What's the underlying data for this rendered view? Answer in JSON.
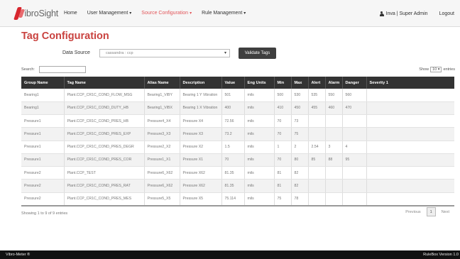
{
  "brand": {
    "name": "VibroSight"
  },
  "nav": {
    "items": [
      {
        "label": "Home",
        "caret": ""
      },
      {
        "label": "User Management",
        "caret": "▾"
      },
      {
        "label": "Source Configuration",
        "caret": "▾"
      },
      {
        "label": "Rule Management",
        "caret": "▾"
      }
    ],
    "active_color": "#e2565a",
    "user": "Inva | Super Admin",
    "logout": "Logout"
  },
  "page": {
    "title": "Tag Configuration",
    "title_color": "#c9423f"
  },
  "datasource": {
    "label": "Data Source",
    "value": "cassandra : ccp",
    "validate_label": "Validate Tags"
  },
  "search": {
    "label": "Search:",
    "value": ""
  },
  "show": {
    "prefix": "Show",
    "value": "10",
    "suffix": "entries"
  },
  "table": {
    "columns": [
      "Group Name",
      "Tag Name",
      "Alias Name",
      "Description",
      "Value",
      "Eng Units",
      "Min",
      "Max",
      "Alert",
      "Alarm",
      "Danger",
      "Severity 1"
    ],
    "rows": [
      [
        "Bearing1",
        "Plant.CCP_CR1C_COND_FLOW_MSG",
        "Bearing1_VIBY",
        "Bearing 1 Y Vibration",
        "501",
        "mils",
        "500",
        "530",
        "535",
        "550",
        "560",
        ""
      ],
      [
        "Bearing1",
        "Plant.CCP_CR1C_COND_DUTY_HB",
        "Bearing1_VIBX",
        "Bearing 1 X Vibration",
        "400",
        "mils",
        "410",
        "450",
        "455",
        "460",
        "470",
        ""
      ],
      [
        "Pressure1",
        "Plant.CCP_CR1C_COND_PRES_HB",
        "Pressure4_X4",
        "Pressure X4",
        "72.56",
        "mils",
        "70",
        "73",
        "",
        "",
        "",
        ""
      ],
      [
        "Pressure1",
        "Plant.CCP_CR1C_COND_PRES_EXP",
        "Pressure3_X3",
        "Pressure X3",
        "73.2",
        "mils",
        "70",
        "75",
        "",
        "",
        "",
        ""
      ],
      [
        "Pressure1",
        "Plant.CCP_CR1C_COND_PRES_DEGR",
        "Pressure2_X2",
        "Pressure X2",
        "1.5",
        "mils",
        "1",
        "2",
        "2.54",
        "3",
        "4",
        ""
      ],
      [
        "Pressure1",
        "Plant.CCP_CR1C_COND_PRES_COR",
        "Pressure1_X1",
        "Pressure X1",
        "70",
        "mils",
        "70",
        "80",
        "85",
        "88",
        "95",
        ""
      ],
      [
        "Pressure2",
        "Plant.CCP_TEST",
        "Pressure6_X62",
        "Pressure X62",
        "81.35",
        "mils",
        "81",
        "82",
        "",
        "",
        "",
        ""
      ],
      [
        "Pressure2",
        "Plant.CCP_CR1C_COND_PRES_RAT",
        "Pressure6_X62",
        "Pressure X62",
        "81.35",
        "mils",
        "81",
        "82",
        "",
        "",
        "",
        ""
      ],
      [
        "Pressure2",
        "Plant.CCP_CR1C_COND_PRES_MES",
        "Pressure5_X5",
        "Pressure X5",
        "75.114",
        "mils",
        "75",
        "78",
        "",
        "",
        "",
        ""
      ]
    ]
  },
  "info": "Showing 1 to 9 of 9 entries",
  "pager": {
    "previous": "Previous",
    "current": "1",
    "next": "Next"
  },
  "footer": {
    "left": "Vibro-Meter ®",
    "right": "RuleBox Version 1.0"
  }
}
